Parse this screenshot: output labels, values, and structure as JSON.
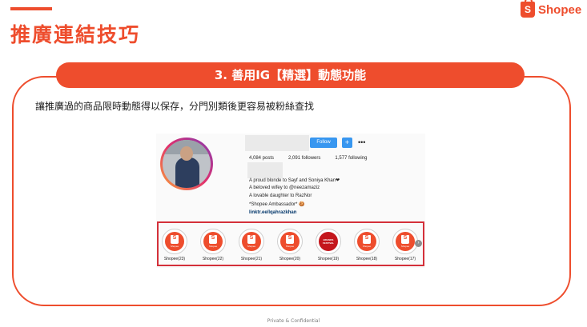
{
  "header": {
    "title": "推廣連結技巧",
    "brand_word": "Shopee",
    "brand_letter": "S"
  },
  "section": {
    "title": "3. 善用IG【精選】動態功能",
    "description": "讓推廣過的商品限時動態得以保存，分門別類後更容易被粉絲查找"
  },
  "profile": {
    "follow_label": "Follow",
    "plus_label": "+",
    "more_label": "•••",
    "stats": {
      "posts": "4,084 posts",
      "followers": "2,091 followers",
      "following": "1,577 following"
    },
    "bio": [
      "A proud blonde to Sayf and Soniya Khan❤",
      "A beloved wifey to @neezamaziz",
      "A lovable daughter to RazNor",
      "*Shopee Ambassador* 🍪"
    ],
    "link": "linktr.ee/lqahrazkhan",
    "highlight_icon_text": "Shopee",
    "brands_icon_text": "BRANDS FESTIVAL",
    "next_label": "›",
    "highlights": [
      {
        "label": "Shopee(23)",
        "type": "shopee"
      },
      {
        "label": "Shopee(22)",
        "type": "shopee"
      },
      {
        "label": "Shopee(21)",
        "type": "shopee"
      },
      {
        "label": "Shopee(20)",
        "type": "shopee"
      },
      {
        "label": "Shopee(19)",
        "type": "brands"
      },
      {
        "label": "Shopee(18)",
        "type": "shopee"
      },
      {
        "label": "Shopee(17)",
        "type": "shopee"
      }
    ]
  },
  "footer": "Private & Confidential",
  "colors": {
    "brand": "#ee4d2d",
    "ig_blue": "#3897f0",
    "highlight_border": "#d4303a"
  }
}
